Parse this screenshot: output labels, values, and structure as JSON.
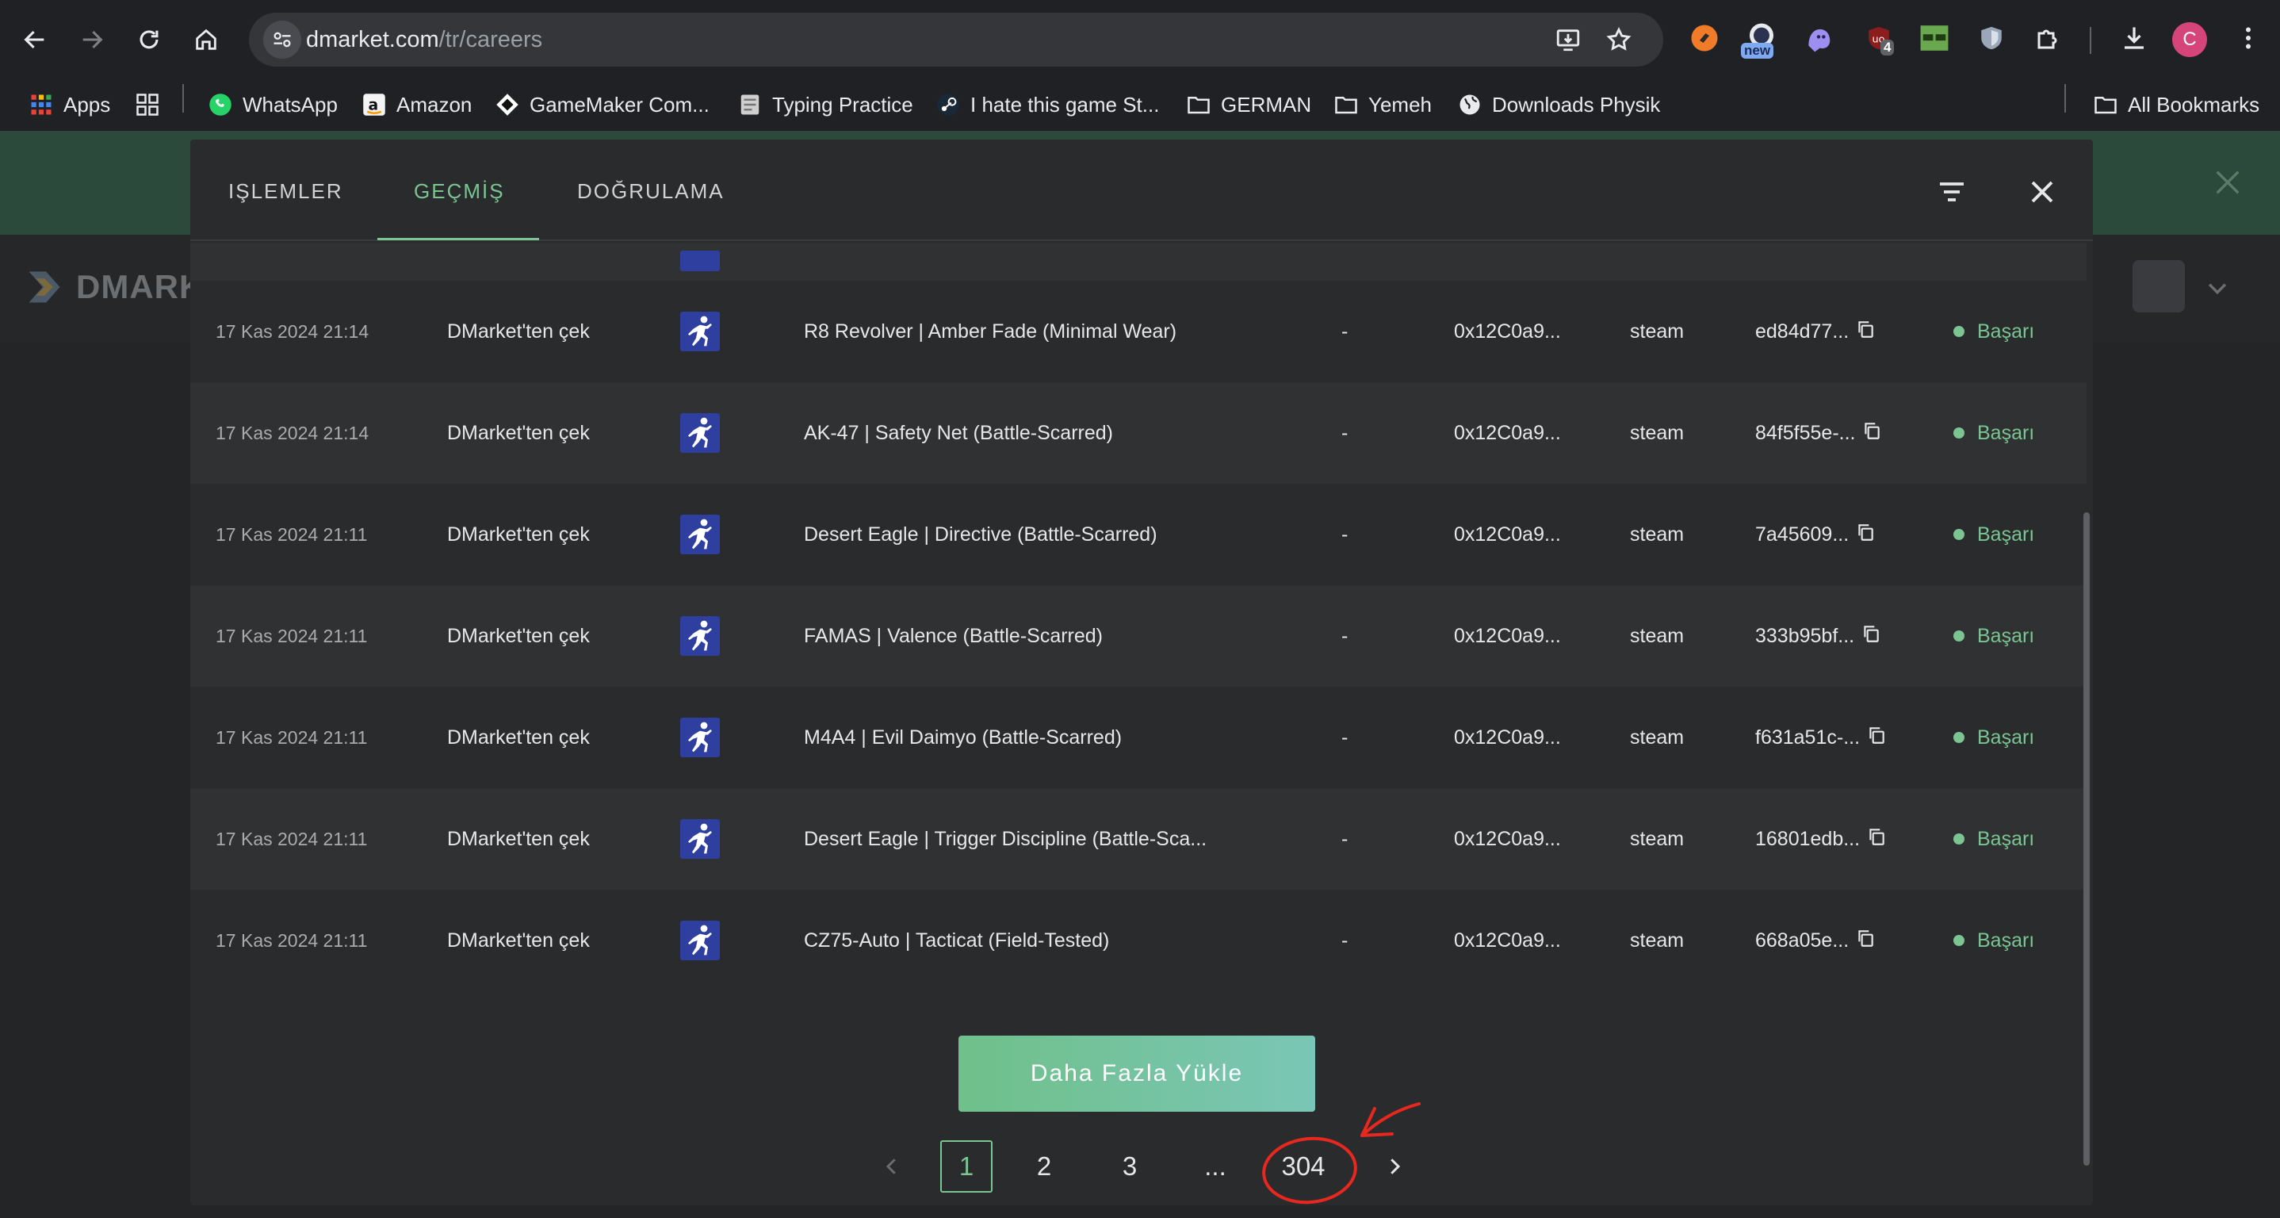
{
  "browser": {
    "url_host": "dmarket.com",
    "url_path": "/tr/careers",
    "new_badge": "new",
    "ext_badge_count": "4",
    "profile_initial": "C"
  },
  "bookmarks": {
    "apps": "Apps",
    "items": [
      "WhatsApp",
      "Amazon",
      "GameMaker Com...",
      "Typing Practice",
      "I hate this game St...",
      "GERMAN",
      "Yemeh",
      "Downloads Physik"
    ],
    "all": "All Bookmarks"
  },
  "site": {
    "logo_text": "DMARKET"
  },
  "modal": {
    "tabs": [
      "IŞLEMLER",
      "GEÇMİŞ",
      "DOĞRULAMA"
    ],
    "active_tab": "GEÇMİŞ",
    "rows": [
      {
        "date": "17 Kas 2024 21:14",
        "type": "DMarket'ten çek",
        "item": "R8 Revolver | Amber Fade (Minimal Wear)",
        "price": "-",
        "wallet": "0x12C0a9...",
        "platform": "steam",
        "txid": "ed84d77...",
        "status": "Başarı"
      },
      {
        "date": "17 Kas 2024 21:14",
        "type": "DMarket'ten çek",
        "item": "AK-47 | Safety Net (Battle-Scarred)",
        "price": "-",
        "wallet": "0x12C0a9...",
        "platform": "steam",
        "txid": "84f5f55e-...",
        "status": "Başarı"
      },
      {
        "date": "17 Kas 2024 21:11",
        "type": "DMarket'ten çek",
        "item": "Desert Eagle | Directive (Battle-Scarred)",
        "price": "-",
        "wallet": "0x12C0a9...",
        "platform": "steam",
        "txid": "7a45609...",
        "status": "Başarı"
      },
      {
        "date": "17 Kas 2024 21:11",
        "type": "DMarket'ten çek",
        "item": "FAMAS | Valence (Battle-Scarred)",
        "price": "-",
        "wallet": "0x12C0a9...",
        "platform": "steam",
        "txid": "333b95bf...",
        "status": "Başarı"
      },
      {
        "date": "17 Kas 2024 21:11",
        "type": "DMarket'ten çek",
        "item": "M4A4 | Evil Daimyo (Battle-Scarred)",
        "price": "-",
        "wallet": "0x12C0a9...",
        "platform": "steam",
        "txid": "f631a51c-...",
        "status": "Başarı"
      },
      {
        "date": "17 Kas 2024 21:11",
        "type": "DMarket'ten çek",
        "item": "Desert Eagle | Trigger Discipline (Battle-Sca...",
        "price": "-",
        "wallet": "0x12C0a9...",
        "platform": "steam",
        "txid": "16801edb...",
        "status": "Başarı"
      },
      {
        "date": "17 Kas 2024 21:11",
        "type": "DMarket'ten çek",
        "item": "CZ75-Auto | Tacticat (Field-Tested)",
        "price": "-",
        "wallet": "0x12C0a9...",
        "platform": "steam",
        "txid": "668a05e...",
        "status": "Başarı"
      }
    ],
    "load_more": "Daha Fazla Yükle",
    "pagination": {
      "pages": [
        "1",
        "2",
        "3",
        "...",
        "304"
      ],
      "current": "1"
    }
  },
  "colors": {
    "accent": "#7ac592",
    "annotation": "#e8281e",
    "modal_bg": "#2a2b2d"
  }
}
